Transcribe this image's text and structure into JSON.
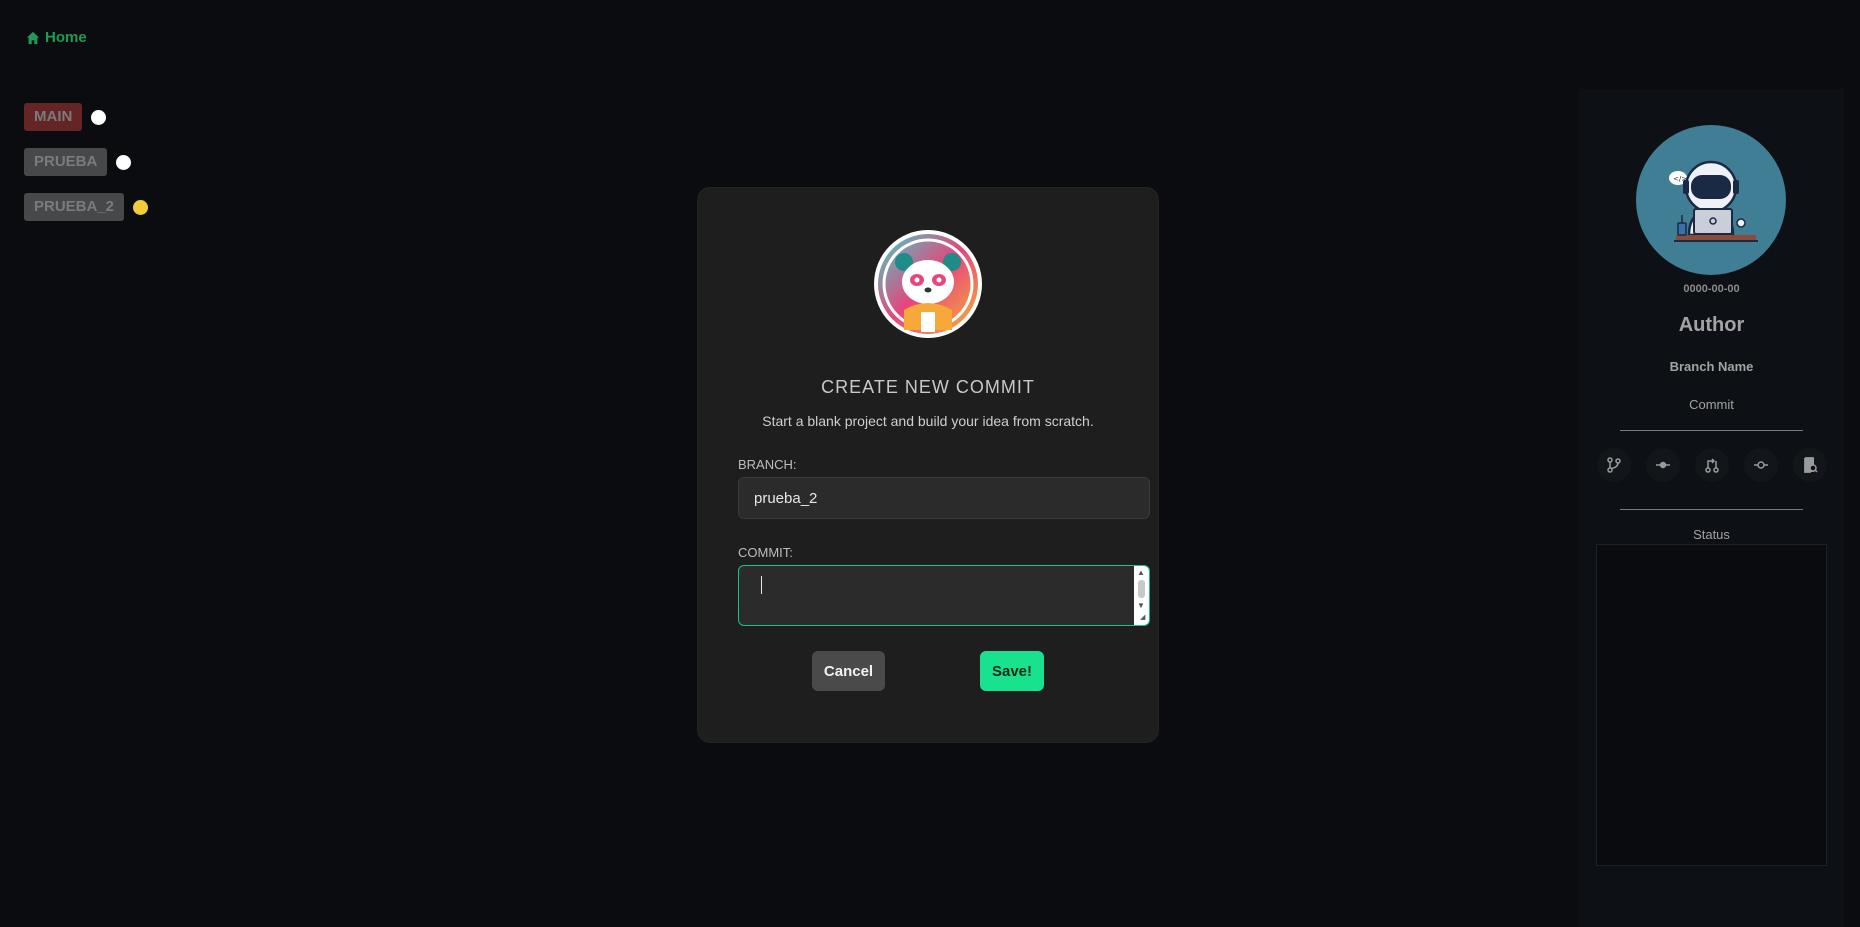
{
  "nav": {
    "home_label": "Home"
  },
  "branches": [
    {
      "label": "MAIN",
      "tag_color": "#b0393a",
      "dot_color": "#ffffff"
    },
    {
      "label": "PRUEBA",
      "tag_color": "#7a7a7a",
      "dot_color": "#ffffff"
    },
    {
      "label": "PRUEBA_2",
      "tag_color": "#7a7a7a",
      "dot_color": "#f2cc38"
    }
  ],
  "modal": {
    "title": "CREATE NEW COMMIT",
    "subtitle": "Start a blank project and build your idea from scratch.",
    "branch_label": "BRANCH:",
    "branch_value": "prueba_2",
    "commit_label": "COMMIT:",
    "commit_value": "",
    "cancel_label": "Cancel",
    "save_label": "Save!"
  },
  "side_panel": {
    "date": "0000-00-00",
    "author": "Author",
    "branch_name": "Branch Name",
    "commit": "Commit",
    "status_label": "Status",
    "actions": [
      "branch-icon",
      "commit-node-icon",
      "merge-icon",
      "commit-icon",
      "search-document-icon"
    ]
  },
  "colors": {
    "accent": "#19e28e",
    "home_link": "#1f9a57",
    "background": "#0a0c0f",
    "modal_bg": "#1e1e1e"
  }
}
